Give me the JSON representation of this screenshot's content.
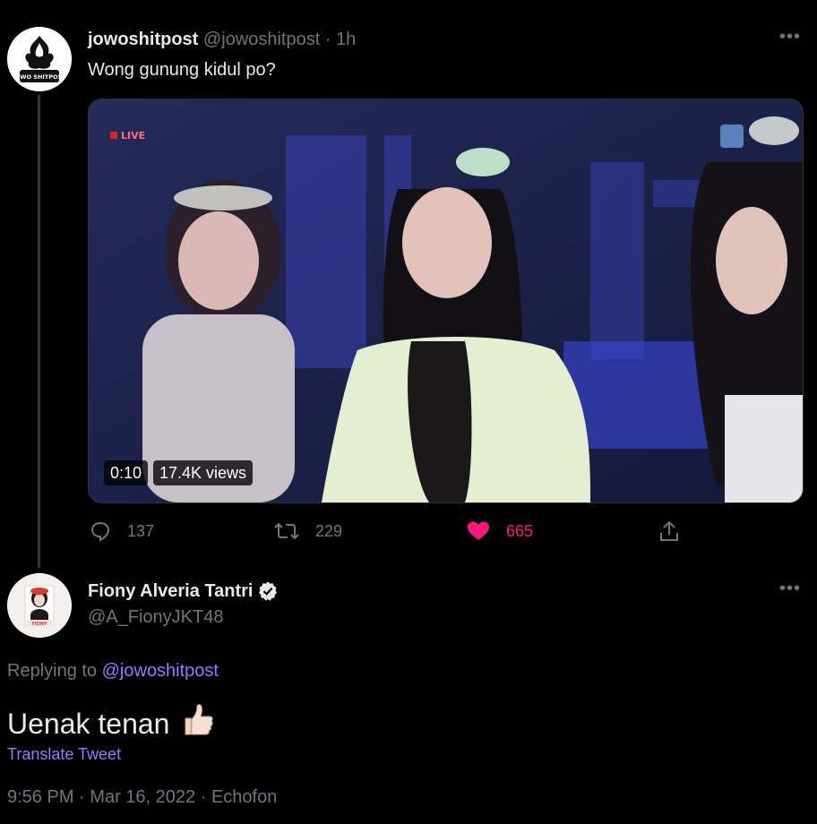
{
  "tweet1": {
    "author_name": "jowoshitpost",
    "author_handle": "@jowoshitpost",
    "separator": "·",
    "time_ago": "1h",
    "text": "Wong gunung kidul po?",
    "avatar_text": "JOWO SHITPOST",
    "video": {
      "live_badge": "LIVE",
      "duration": "0:10",
      "views": "17.4K views"
    },
    "actions": {
      "replies": "137",
      "retweets": "229",
      "likes": "665"
    },
    "more_icon": "more-icon"
  },
  "tweet2": {
    "author_name": "Fiony Alveria Tantri",
    "author_handle": "@A_FionyJKT48",
    "verified": true,
    "avatar_text": "FIONY",
    "replying_prefix": "Replying to",
    "replying_to": "@jowoshitpost",
    "text": "Uenak tenan",
    "emoji": "thumbs-up-emoji",
    "translate_label": "Translate Tweet",
    "timestamp": "9:56 PM",
    "date": "Mar 16, 2022",
    "source": "Echofon",
    "meta_separator": "·"
  },
  "colors": {
    "background": "#000000",
    "text": "#e7e9ea",
    "muted": "#71767b",
    "like": "#f91880",
    "link": "#8f7cff"
  }
}
